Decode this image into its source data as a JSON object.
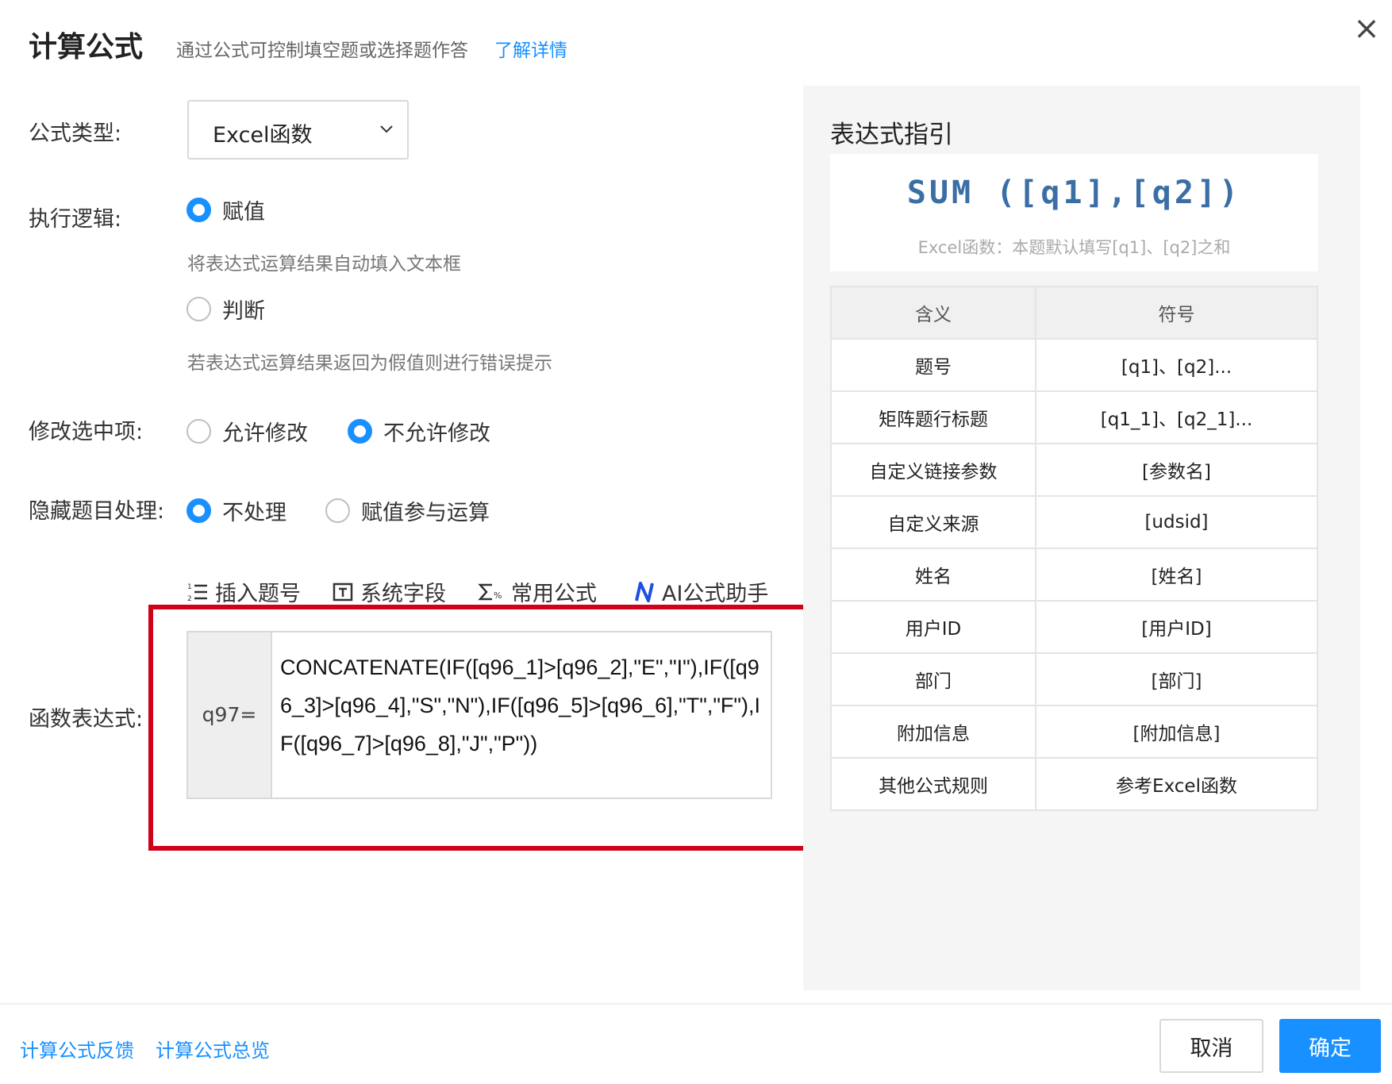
{
  "header": {
    "title": "计算公式",
    "subtitle": "通过公式可控制填空题或选择题作答",
    "learn_more": "了解详情",
    "close_glyph": "×"
  },
  "form": {
    "formula_type_label": "公式类型:",
    "formula_type_value": "Excel函数",
    "logic_label": "执行逻辑:",
    "logic_assign": "赋值",
    "logic_assign_hint": "将表达式运算结果自动填入文本框",
    "logic_judge": "判断",
    "logic_judge_hint": "若表达式运算结果返回为假值则进行错误提示",
    "modify_label": "修改选中项:",
    "modify_allow": "允许修改",
    "modify_deny": "不允许修改",
    "hidden_label": "隐藏题目处理:",
    "hidden_none": "不处理",
    "hidden_assign": "赋值参与运算",
    "expr_label": "函数表达式:",
    "expr_prefix": "q97=",
    "expr_value": "CONCATENATE(IF([q96_1]>[q96_2],\"E\",\"I\"),IF([q96_3]>[q96_4],\"S\",\"N\"),IF([q96_5]>[q96_6],\"T\",\"F\"),IF([q96_7]>[q96_8],\"J\",\"P\"))"
  },
  "toolbar": {
    "insert_question": "插入题号",
    "system_field": "系统字段",
    "common_formula": "常用公式",
    "ai_assistant": "AI公式助手"
  },
  "guide": {
    "title": "表达式指引",
    "example_formula": "SUM ([q1],[q2])",
    "example_desc": "Excel函数：本题默认填写[q1]、[q2]之和",
    "columns": [
      "含义",
      "符号"
    ],
    "rows": [
      [
        "题号",
        "[q1]、[q2]..."
      ],
      [
        "矩阵题行标题",
        "[q1_1]、[q2_1]..."
      ],
      [
        "自定义链接参数",
        "[参数名]"
      ],
      [
        "自定义来源",
        "[udsid]"
      ],
      [
        "姓名",
        "[姓名]"
      ],
      [
        "用户ID",
        "[用户ID]"
      ],
      [
        "部门",
        "[部门]"
      ],
      [
        "附加信息",
        "[附加信息]"
      ],
      [
        "其他公式规则",
        "参考Excel函数"
      ]
    ]
  },
  "footer": {
    "feedback": "计算公式反馈",
    "overview": "计算公式总览",
    "cancel": "取消",
    "confirm": "确定"
  },
  "colors": {
    "accent": "#1890ff",
    "highlight": "#d0021b"
  }
}
